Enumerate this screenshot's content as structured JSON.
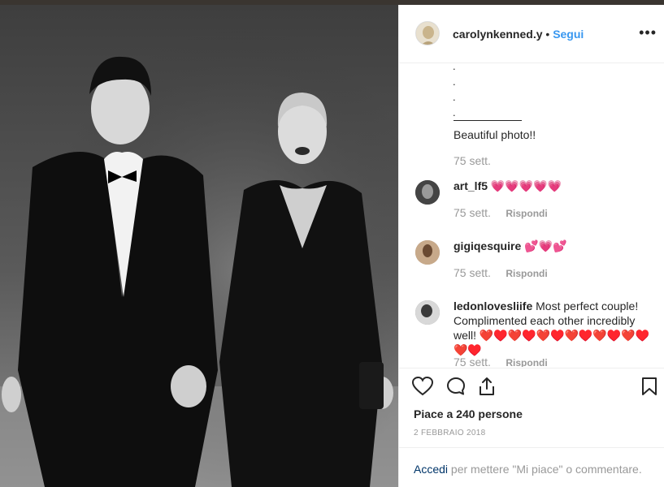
{
  "header": {
    "username": "carolynkenned.y",
    "separator": "•",
    "follow_label": "Segui",
    "more_label": "•••"
  },
  "caption": {
    "dots": [
      ".",
      ".",
      ".",
      "."
    ],
    "text": "Beautiful photo!!",
    "time": "75 sett."
  },
  "comments": [
    {
      "username": "art_lf5",
      "text": "",
      "emoji": "💗💗💗💗💗",
      "time": "75 sett.",
      "reply_label": "Rispondi"
    },
    {
      "username": "gigiqesquire",
      "text": "",
      "emoji": "💕💗💕",
      "time": "75 sett.",
      "reply_label": "Rispondi"
    },
    {
      "username": "ledonlovesliife",
      "text": "Most perfect couple! Complimented each other incredibly well!",
      "emoji": "❤️♥️❤️♥️❤️♥️❤️♥️❤️♥️❤️♥️❤️♥️",
      "time": "75 sett.",
      "reply_label": "Rispondi"
    }
  ],
  "actions": {
    "likes_text": "Piace a 240 persone",
    "date": "2 FEBBRAIO 2018",
    "login_link": "Accedi",
    "login_rest": " per mettere \"Mi piace\" o commentare."
  },
  "colors": {
    "accent": "#3897f0",
    "text": "#262626",
    "muted": "#999999"
  }
}
